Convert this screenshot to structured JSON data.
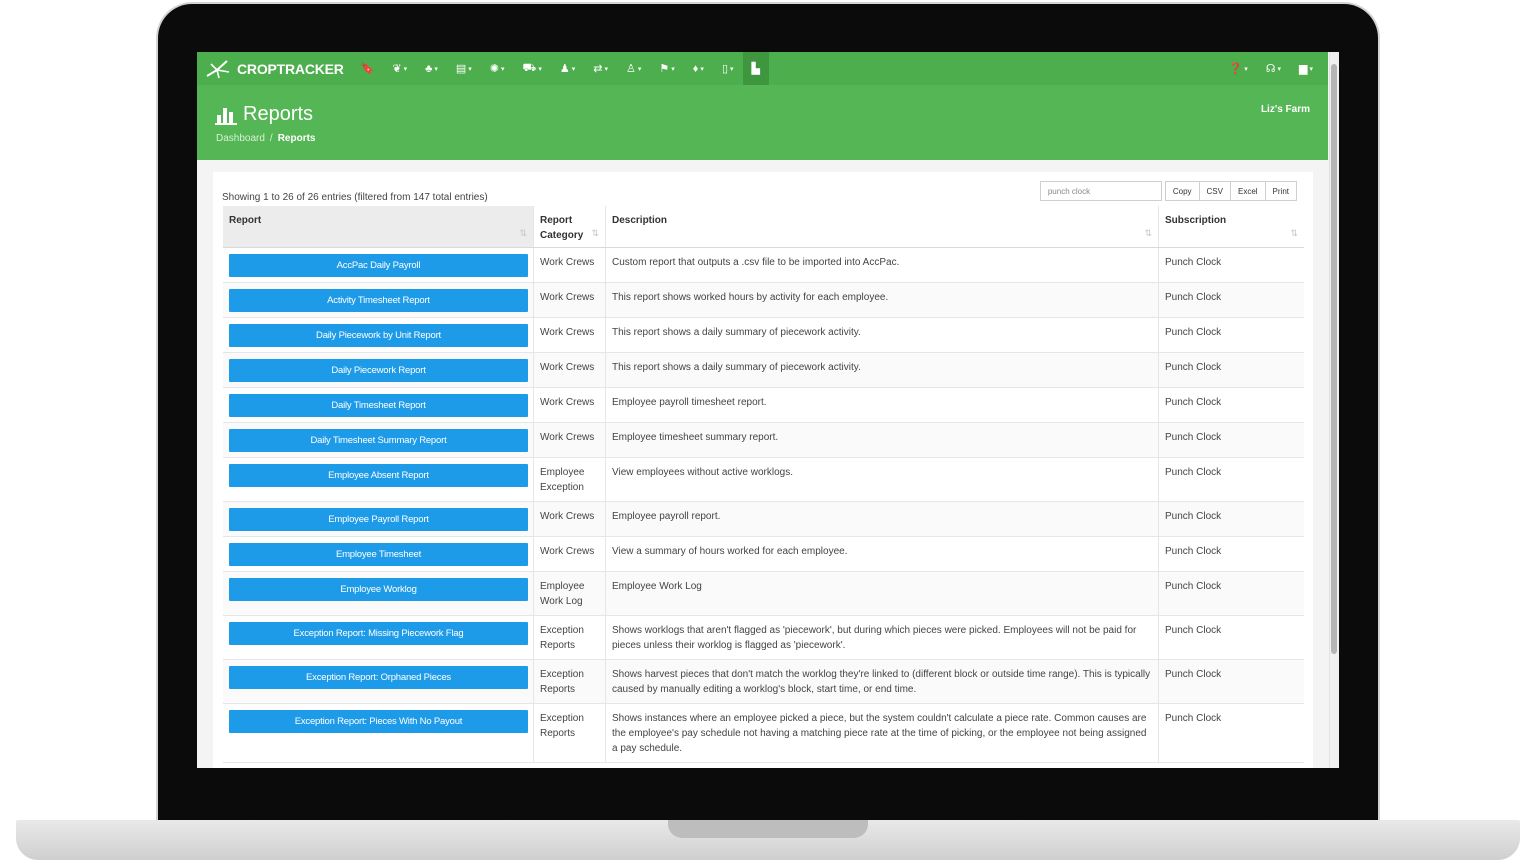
{
  "app": {
    "brand": "CROPTRACKER",
    "accent_color": "#4cae4c",
    "button_color": "#1e9be8"
  },
  "navbar": {
    "icons": [
      {
        "name": "bookmark-icon",
        "glyph": "🔖",
        "dropdown": false
      },
      {
        "name": "leaf-icon",
        "glyph": "❦",
        "dropdown": true
      },
      {
        "name": "basket-icon",
        "glyph": "♣",
        "dropdown": true
      },
      {
        "name": "document-icon",
        "glyph": "▤",
        "dropdown": true
      },
      {
        "name": "settings-icon",
        "glyph": "✺",
        "dropdown": true
      },
      {
        "name": "truck-icon",
        "glyph": "⛟",
        "dropdown": true
      },
      {
        "name": "user-icon",
        "glyph": "♟",
        "dropdown": true
      },
      {
        "name": "exchange-icon",
        "glyph": "⇄",
        "dropdown": true
      },
      {
        "name": "person-icon",
        "glyph": "♙",
        "dropdown": true
      },
      {
        "name": "flag-icon",
        "glyph": "⚑",
        "dropdown": true
      },
      {
        "name": "location-icon",
        "glyph": "♦",
        "dropdown": true
      },
      {
        "name": "mobile-icon",
        "glyph": "▯",
        "dropdown": true
      },
      {
        "name": "reports-icon",
        "glyph": "▙",
        "dropdown": false,
        "active": true
      }
    ],
    "right_icons": [
      {
        "name": "help-icon",
        "glyph": "❓"
      },
      {
        "name": "support-icon",
        "glyph": "☊"
      },
      {
        "name": "briefcase-icon",
        "glyph": "▆"
      }
    ]
  },
  "header": {
    "title": "Reports",
    "breadcrumb": {
      "home": "Dashboard",
      "separator": "/",
      "current": "Reports"
    },
    "farm": "Liz's Farm"
  },
  "table_info": "Showing 1 to 26 of 26 entries (filtered from 147 total entries)",
  "toolbar": {
    "search_value": "punch clock",
    "copy": "Copy",
    "csv": "CSV",
    "excel": "Excel",
    "print": "Print"
  },
  "columns": {
    "report": "Report",
    "category": "Report Category",
    "description": "Description",
    "subscription": "Subscription"
  },
  "rows": [
    {
      "report": "AccPac Daily Payroll",
      "category": "Work Crews",
      "description": "Custom report that outputs a .csv file to be imported into AccPac.",
      "subscription": "Punch Clock"
    },
    {
      "report": "Activity Timesheet Report",
      "category": "Work Crews",
      "description": "This report shows worked hours by activity for each employee.",
      "subscription": "Punch Clock"
    },
    {
      "report": "Daily Piecework by Unit Report",
      "category": "Work Crews",
      "description": "This report shows a daily summary of piecework activity.",
      "subscription": "Punch Clock"
    },
    {
      "report": "Daily Piecework Report",
      "category": "Work Crews",
      "description": "This report shows a daily summary of piecework activity.",
      "subscription": "Punch Clock"
    },
    {
      "report": "Daily Timesheet Report",
      "category": "Work Crews",
      "description": "Employee payroll timesheet report.",
      "subscription": "Punch Clock"
    },
    {
      "report": "Daily Timesheet Summary Report",
      "category": "Work Crews",
      "description": "Employee timesheet summary report.",
      "subscription": "Punch Clock"
    },
    {
      "report": "Employee Absent Report",
      "category": "Employee Exception",
      "description": "View employees without active worklogs.",
      "subscription": "Punch Clock"
    },
    {
      "report": "Employee Payroll Report",
      "category": "Work Crews",
      "description": "Employee payroll report.",
      "subscription": "Punch Clock"
    },
    {
      "report": "Employee Timesheet",
      "category": "Work Crews",
      "description": "View a summary of hours worked for each employee.",
      "subscription": "Punch Clock"
    },
    {
      "report": "Employee Worklog",
      "category": "Employee Work Log",
      "description": "Employee Work Log",
      "subscription": "Punch Clock"
    },
    {
      "report": "Exception Report: Missing Piecework Flag",
      "category": "Exception Reports",
      "description": "Shows worklogs that aren't flagged as 'piecework', but during which pieces were picked. Employees will not be paid for pieces unless their worklog is flagged as 'piecework'.",
      "subscription": "Punch Clock"
    },
    {
      "report": "Exception Report: Orphaned Pieces",
      "category": "Exception Reports",
      "description": "Shows harvest pieces that don't match the worklog they're linked to (different block or outside time range). This is typically caused by manually editing a worklog's block, start time, or end time.",
      "subscription": "Punch Clock"
    },
    {
      "report": "Exception Report: Pieces With No Payout",
      "category": "Exception Reports",
      "description": "Shows instances where an employee picked a piece, but the system couldn't calculate a piece rate. Common causes are the employee's pay schedule not having a matching piece rate at the time of picking, or the employee not being assigned a pay schedule.",
      "subscription": "Punch Clock"
    }
  ]
}
